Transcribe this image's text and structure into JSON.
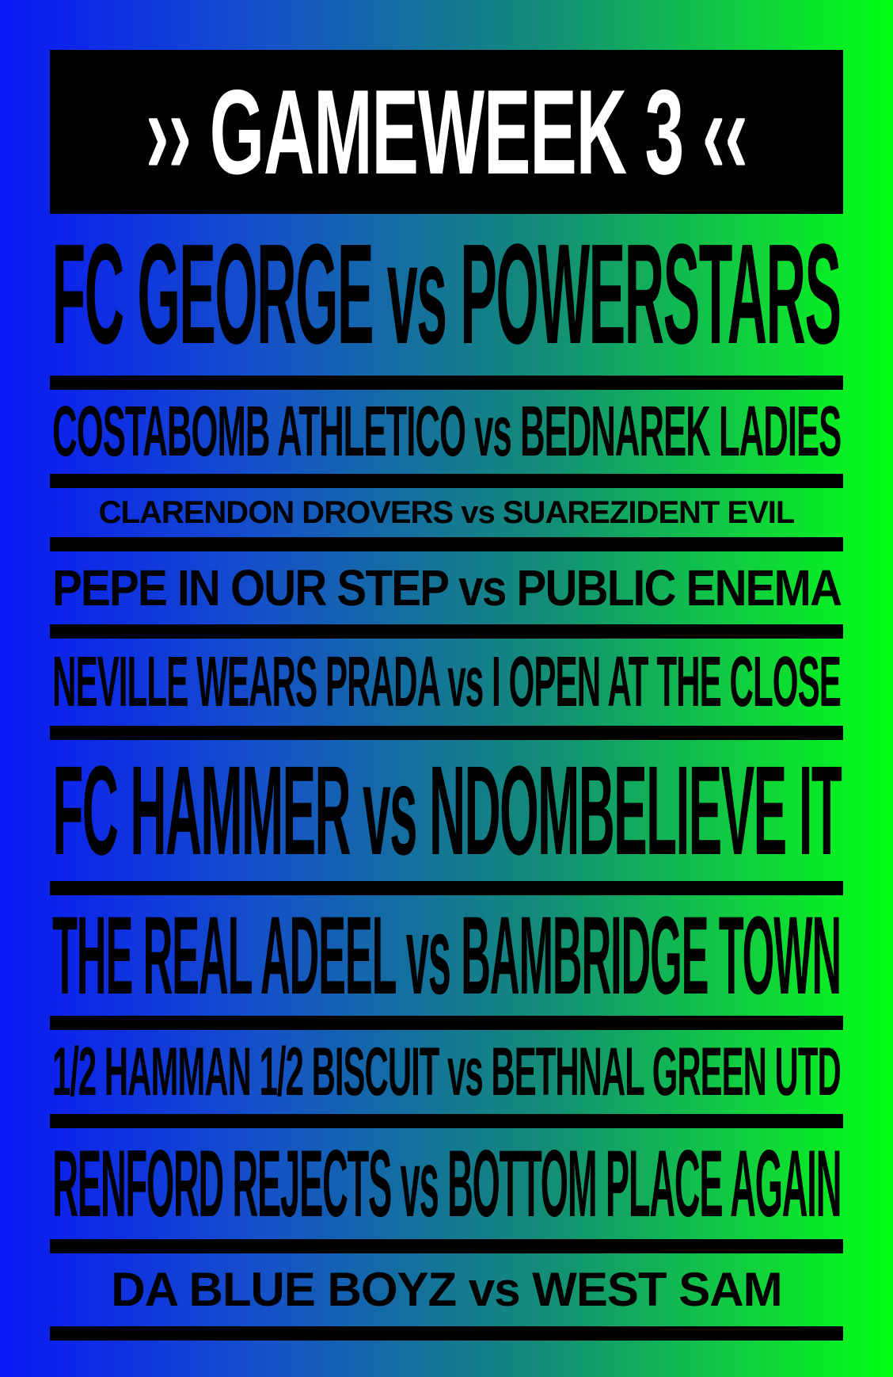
{
  "header": {
    "title": "›› GAMEWEEK 3 ‹‹"
  },
  "fixtures": [
    {
      "home": "FC GEORGE",
      "vs": "vs",
      "away": "POWERSTARS"
    },
    {
      "home": "COSTABOMB ATHLETICO",
      "vs": "vs",
      "away": "BEDNAREK LADIES"
    },
    {
      "home": "CLARENDON DROVERS",
      "vs": "vs",
      "away": "SUAREZIDENT EVIL"
    },
    {
      "home": "PEPE IN OUR STEP",
      "vs": "vs",
      "away": "PUBLIC ENEMA"
    },
    {
      "home": "NEVILLE WEARS PRADA",
      "vs": "vs",
      "away": "I OPEN AT THE CLOSE"
    },
    {
      "home": "FC HAMMER",
      "vs": "vs",
      "away": "NDOMBELIEVE IT"
    },
    {
      "home": "THE REAL ADEEL",
      "vs": "vs",
      "away": "BAMBRIDGE TOWN"
    },
    {
      "home": "1/2 HAMMAN 1/2 BISCUIT",
      "vs": "vs",
      "away": "BETHNAL GREEN UTD"
    },
    {
      "home": "RENFORD REJECTS",
      "vs": "vs",
      "away": "BOTTOM PLACE AGAIN"
    },
    {
      "home": "DA BLUE BOYZ",
      "vs": "vs",
      "away": "WEST SAM"
    }
  ],
  "colors": {
    "text": "#000000",
    "banner_bg": "#000000",
    "banner_text": "#ffffff",
    "gradient_left": "#0a17f5",
    "gradient_right": "#00ff14"
  }
}
